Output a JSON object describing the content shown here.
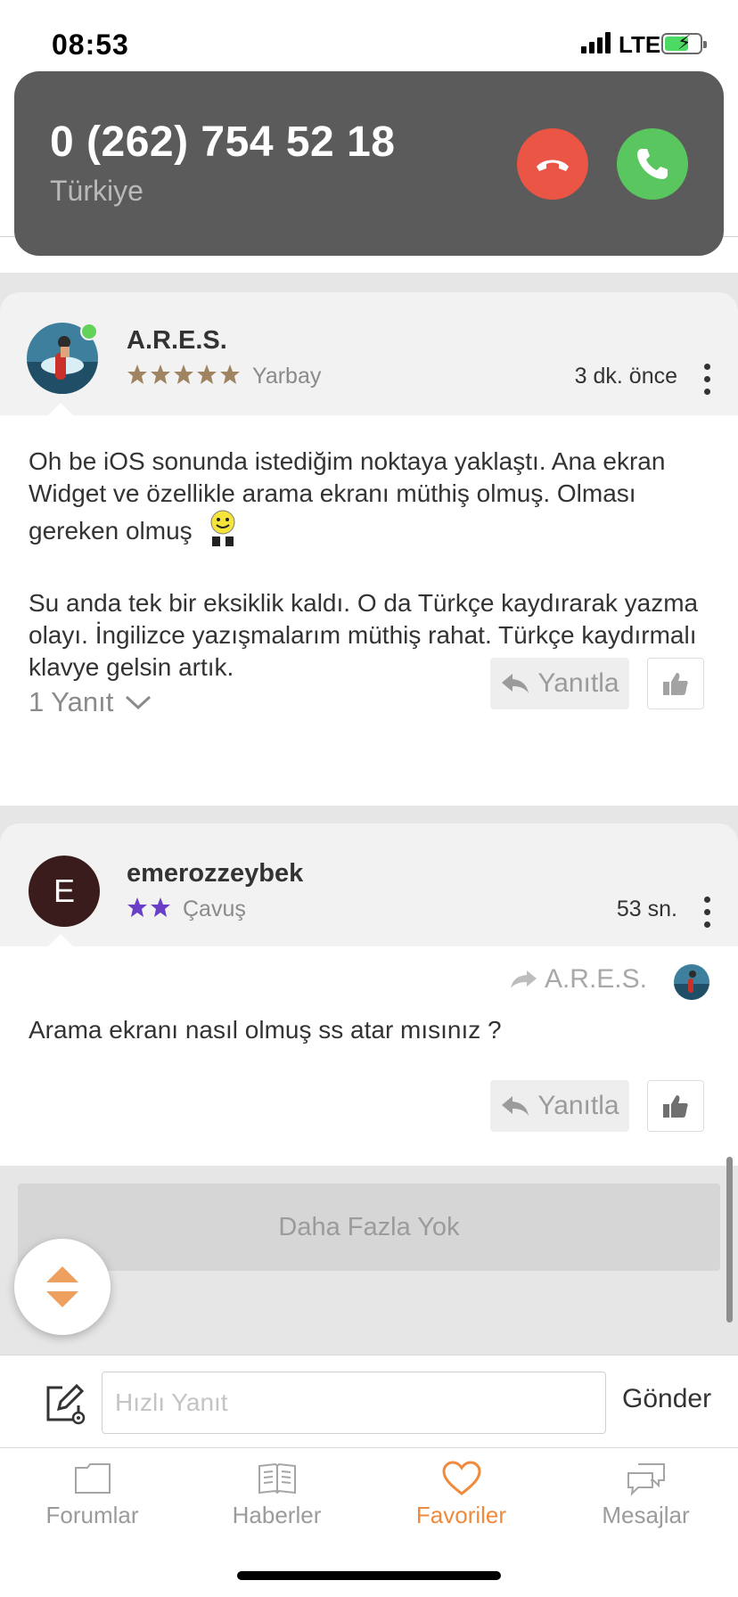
{
  "status_bar": {
    "time": "08:53",
    "network": "LTE"
  },
  "incoming_call": {
    "number": "0 (262) 754 52 18",
    "country": "Türkiye"
  },
  "posts": [
    {
      "author": "A.R.E.S.",
      "rank": "Yarbay",
      "stars": 5,
      "star_color": "#a08462",
      "time": "3 dk. önce",
      "online": true,
      "paragraphs": [
        "Oh be iOS sonunda istediğim noktaya yaklaştı. Ana ekran Widget ve özellikle arama ekranı müthiş olmuş. Olması gereken olmuş",
        "Su anda tek bir eksiklik kaldı. O da Türkçe kaydırarak yazma olayı. İngilizce yazışmalarım müthiş rahat. Türkçe kaydırmalı klavye gelsin artık."
      ],
      "replies_label": "1 Yanıt",
      "reply_label": "Yanıtla"
    },
    {
      "author": "emerozzeybek",
      "avatar_letter": "E",
      "rank": "Çavuş",
      "stars": 2,
      "star_color": "#6a3fc7",
      "time": "53 sn.",
      "quoted_author": "A.R.E.S.",
      "text": "Arama ekranı nasıl olmuş ss atar mısınız ?",
      "reply_label": "Yanıtla"
    }
  ],
  "more_label": "Daha Fazla Yok",
  "composer": {
    "placeholder": "Hızlı Yanıt",
    "send_label": "Gönder"
  },
  "tabs": [
    {
      "label": "Forumlar",
      "icon": "folder-icon"
    },
    {
      "label": "Haberler",
      "icon": "newspaper-icon"
    },
    {
      "label": "Favoriler",
      "icon": "heart-icon",
      "active": true
    },
    {
      "label": "Mesajlar",
      "icon": "chat-bubbles-icon"
    }
  ],
  "colors": {
    "accent": "#f08a3c",
    "decline": "#eb5545",
    "accept": "#5ac65f",
    "banner": "#5b5b5b"
  }
}
